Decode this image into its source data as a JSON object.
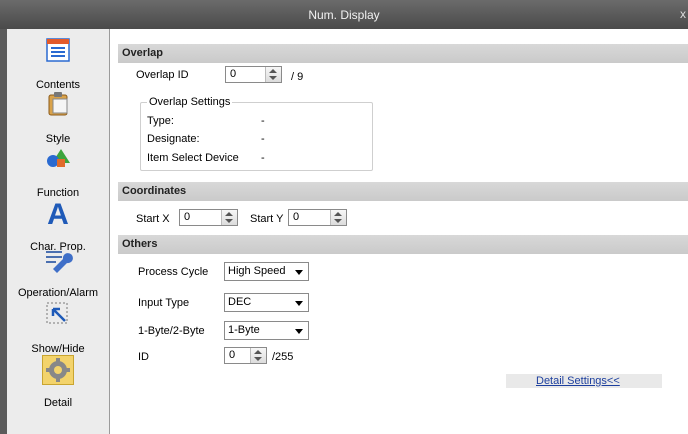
{
  "window": {
    "title": "Num. Display",
    "close_glyph": "x"
  },
  "sidebar": {
    "items": [
      {
        "label": "Contents",
        "icon": "contents-icon"
      },
      {
        "label": "Style",
        "icon": "clipboard-icon"
      },
      {
        "label": "Function",
        "icon": "shapes-icon"
      },
      {
        "label": "Char. Prop.",
        "icon": "letter-a-icon"
      },
      {
        "label": "Operation/Alarm",
        "icon": "wrench-icon"
      },
      {
        "label": "Show/Hide",
        "icon": "cursor-icon"
      },
      {
        "label": "Detail",
        "icon": "gear-icon",
        "active": true
      }
    ]
  },
  "overlap": {
    "header": "Overlap",
    "id_label": "Overlap ID",
    "id_value": "0",
    "id_max": "/ 9",
    "settings": {
      "legend": "Overlap Settings",
      "type_label": "Type:",
      "type_value": "-",
      "designate_label": "Designate:",
      "designate_value": "-",
      "item_select_label": "Item Select Device",
      "item_select_value": "-"
    }
  },
  "coordinates": {
    "header": "Coordinates",
    "start_x_label": "Start X",
    "start_x_value": "0",
    "start_y_label": "Start Y",
    "start_y_value": "0"
  },
  "others": {
    "header": "Others",
    "process_cycle_label": "Process Cycle",
    "process_cycle_value": "High Speed",
    "input_type_label": "Input Type",
    "input_type_value": "DEC",
    "byte_label": "1-Byte/2-Byte",
    "byte_value": "1-Byte",
    "id_label": "ID",
    "id_value": "0",
    "id_max": "/255"
  },
  "detail_link": "Detail Settings<<",
  "colors": {
    "accent_link": "#1d3f9e",
    "title_bar": "#555555",
    "active_item": "#f3d36b"
  }
}
